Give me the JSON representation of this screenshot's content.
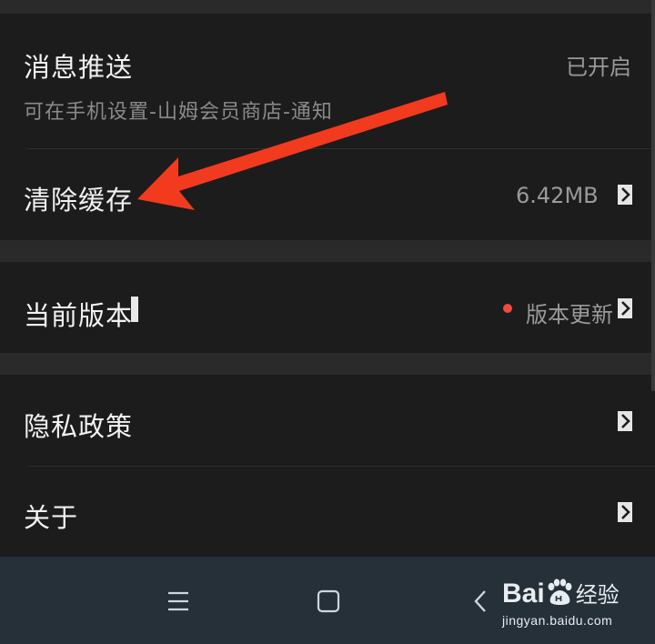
{
  "settings": {
    "push": {
      "title": "消息推送",
      "subtitle": "可在手机设置-山姆会员商店-通知",
      "value": "已开启"
    },
    "cache": {
      "title": "清除缓存",
      "value": "6.42MB"
    },
    "version": {
      "title": "当前版本",
      "value": "版本更新"
    },
    "privacy": {
      "title": "隐私政策"
    },
    "about": {
      "title": "关于"
    }
  },
  "watermark": {
    "brand_latin": "Bai",
    "brand_cn": "经验",
    "url": "jingyan.baidu.com"
  },
  "icons": {
    "chevron": "chevron-right-icon",
    "menu": "menu-icon",
    "home": "home-icon",
    "back": "back-icon",
    "paw": "baidu-paw-icon"
  },
  "colors": {
    "accent_dot": "#ee4b3f",
    "annotation_arrow": "#f23a1e",
    "navbar": "#253039"
  }
}
